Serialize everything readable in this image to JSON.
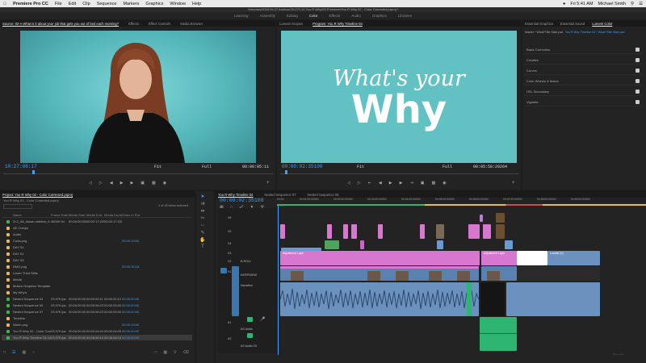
{
  "menubar": {
    "apple": "",
    "app": "Premiere Pro CC",
    "items": [
      "File",
      "Edit",
      "Clip",
      "Sequence",
      "Markers",
      "Graphics",
      "Window",
      "Help"
    ],
    "status": [
      "Fri 5:41 AM",
      "Michael Smith"
    ]
  },
  "titlebar": "/Volumes/2018.04.27 Archive/2017/3.14 You R Why/03 Premiere/You R Why 02 - Color Corrected.prproj *",
  "workspaces": [
    "Learning",
    "Assembly",
    "Editing",
    "Color",
    "Effects",
    "Audio",
    "Graphics",
    "Libraries"
  ],
  "source_panel": {
    "tabs": [
      "Source: 02-A What is it about your job that gets you out of bed each morning?",
      "Effects",
      "Effect Controls",
      "Media Browser"
    ],
    "timecode": "10:27:08:17",
    "fit": "Fit",
    "quality": "Full",
    "duration": "00:00:05:11"
  },
  "program_panel": {
    "tabs": [
      "Lumetri Scopes",
      "Program: You R Why Timeline 04"
    ],
    "timecode": "00:00:02:35108",
    "fit": "Fit",
    "quality": "Full",
    "duration": "00:05:58:29264",
    "title_line1": "What's your",
    "title_line2": "Why"
  },
  "lumetri": {
    "tabs": [
      "Essential Graphics",
      "Essential Sound",
      "Lumetri Color"
    ],
    "master": "Master * What?Title Slide.psd",
    "clip": "You R Why Timeline 04 * What?Title Slide.psd",
    "sections": [
      "Basic Correction",
      "Creative",
      "Curves",
      "Color Wheels & Match",
      "HSL Secondary",
      "Vignette"
    ]
  },
  "project": {
    "tab": "Project: You R Why 02 - Color Corrected.prproj",
    "path": "You R Why 02 - Color Corrected.prproj",
    "count": "1 of 15 items selected",
    "headers": [
      "Name",
      "Frame Rate",
      "Media Start",
      "Media End",
      "Media Duration",
      "Video In Point"
    ],
    "rows": [
      {
        "color": "#3fb24f",
        "name": "2L2_All_drawn-sidebar_0:",
        "fr": "48000 Hz",
        "ms": "00:00:00:00000",
        "me": "00:02:17:22087",
        "md": "00:02:17:22088",
        "vi": ""
      },
      {
        "color": "#e8b84a",
        "name": "AE Comps",
        "fr": "",
        "ms": "",
        "me": "",
        "md": "",
        "vi": ""
      },
      {
        "color": "#e8b84a",
        "name": "Audio",
        "fr": "",
        "ms": "",
        "me": "",
        "md": "",
        "vi": ""
      },
      {
        "color": "#e8b84a",
        "name": "Coda.png",
        "fr": "",
        "ms": "",
        "me": "",
        "md": "",
        "vi": "00:00:13:00"
      },
      {
        "color": "#e8b84a",
        "name": "DAY 01",
        "fr": "",
        "ms": "",
        "me": "",
        "md": "",
        "vi": ""
      },
      {
        "color": "#e8b84a",
        "name": "DAY 02",
        "fr": "",
        "ms": "",
        "me": "",
        "md": "",
        "vi": ""
      },
      {
        "color": "#e8b84a",
        "name": "DAY 03",
        "fr": "",
        "ms": "",
        "me": "",
        "md": "",
        "vi": ""
      },
      {
        "color": "#e8b84a",
        "name": "EMO.png",
        "fr": "",
        "ms": "",
        "me": "",
        "md": "",
        "vi": "00:00:15:18"
      },
      {
        "color": "#e8b84a",
        "name": "Lower Third Stills",
        "fr": "",
        "ms": "",
        "me": "",
        "md": "",
        "vi": ""
      },
      {
        "color": "#e8b84a",
        "name": "Media",
        "fr": "",
        "ms": "",
        "me": "",
        "md": "",
        "vi": ""
      },
      {
        "color": "#e8b84a",
        "name": "Motion Graphics Template",
        "fr": "",
        "ms": "",
        "me": "",
        "md": "",
        "vi": ""
      },
      {
        "color": "#e8b84a",
        "name": "My Why's",
        "fr": "",
        "ms": "",
        "me": "",
        "md": "",
        "vi": ""
      },
      {
        "color": "#3fb24f",
        "name": "Nested Sequence 04",
        "fr": "23.976 fps",
        "ms": "00:00:00:00",
        "me": "00:00:02:11",
        "md": "00:00:02:12",
        "vi": "00:00:00:00"
      },
      {
        "color": "#3fb24f",
        "name": "Nested Sequence 06",
        "fr": "23.976 fps",
        "ms": "00:00:00:00",
        "me": "00:00:08:23",
        "md": "00:00:09:00",
        "vi": "00:00:00:00"
      },
      {
        "color": "#3fb24f",
        "name": "Nested Sequence 07",
        "fr": "23.976 fps",
        "ms": "00:00:00:00",
        "me": "00:00:08:23",
        "md": "00:00:09:00",
        "vi": "00:00:00:00"
      },
      {
        "color": "#e8b84a",
        "name": "Timeline",
        "fr": "",
        "ms": "",
        "me": "",
        "md": "",
        "vi": ""
      },
      {
        "color": "#e8b84a",
        "name": "Warm.png",
        "fr": "",
        "ms": "",
        "me": "",
        "md": "",
        "vi": "00:00:13:00"
      },
      {
        "color": "#3fb24f",
        "name": "You R Why 02 - Color Correct",
        "fr": "23.976 fps",
        "ms": "00:00:00:00",
        "me": "00:00:04:04",
        "md": "00:00:04:05",
        "vi": "00:00:00:00"
      },
      {
        "color": "#3fb24f",
        "name": "You R Why Timeline 04 04",
        "fr": "23.976 fps",
        "ms": "00:00:00:00",
        "me": "00:06:06:14",
        "md": "00:06:06:15",
        "vi": "00:00:00:00"
      }
    ]
  },
  "timeline": {
    "tabs": [
      "You R Why Timeline 04",
      "Nested Sequence 07",
      "Nested Sequence 06"
    ],
    "timecode": "00:00:02:35108",
    "ruler": [
      "00:00",
      "00:01:00:00000",
      "00:02:00:00000",
      "00:03:00:00000",
      "00:04:00:00000",
      "00:05:00:00000",
      "00:06:00:00000",
      "00:07:00:00000",
      "00:08:00:00000",
      "00:09:00:00000"
    ],
    "track_labels": [
      "V6",
      "V5",
      "V4",
      "V3",
      "V2",
      "V1",
      "A1",
      "A2"
    ],
    "extra_labels": [
      "B-ROLL",
      "INTERVIEW",
      "Narration",
      "AS Audio",
      "AS Audio 03"
    ],
    "clip_labels": [
      "Adjustment Layer",
      "Adjustment Layer",
      "Adjustment Layer",
      "Lumetri [V]"
    ]
  },
  "colors": {
    "accent_blue": "#3aa0ff",
    "teal": "#4dc3c3",
    "pink": "#d777d0",
    "audio_blue": "#6b91be",
    "green": "#2fb572"
  }
}
